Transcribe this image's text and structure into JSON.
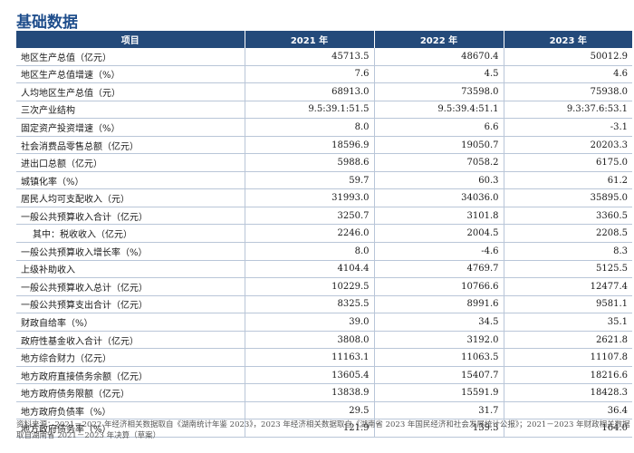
{
  "title": "基础数据",
  "table": {
    "headers": [
      "项目",
      "2021 年",
      "2022 年",
      "2023 年"
    ],
    "rows": [
      {
        "label": "地区生产总值（亿元）",
        "v2021": "45713.5",
        "v2022": "48670.4",
        "v2023": "50012.9"
      },
      {
        "label": "地区生产总值增速（%）",
        "v2021": "7.6",
        "v2022": "4.5",
        "v2023": "4.6"
      },
      {
        "label": "人均地区生产总值（元）",
        "v2021": "68913.0",
        "v2022": "73598.0",
        "v2023": "75938.0"
      },
      {
        "label": "三次产业结构",
        "v2021": "9.5:39.1:51.5",
        "v2022": "9.5:39.4:51.1",
        "v2023": "9.3:37.6:53.1"
      },
      {
        "label": "固定资产投资增速（%）",
        "v2021": "8.0",
        "v2022": "6.6",
        "v2023": "-3.1"
      },
      {
        "label": "社会消费品零售总额（亿元）",
        "v2021": "18596.9",
        "v2022": "19050.7",
        "v2023": "20203.3"
      },
      {
        "label": "进出口总额（亿元）",
        "v2021": "5988.6",
        "v2022": "7058.2",
        "v2023": "6175.0"
      },
      {
        "label": "城镇化率（%）",
        "v2021": "59.7",
        "v2022": "60.3",
        "v2023": "61.2"
      },
      {
        "label": "居民人均可支配收入（元）",
        "v2021": "31993.0",
        "v2022": "34036.0",
        "v2023": "35895.0"
      },
      {
        "label": "一般公共预算收入合计（亿元）",
        "v2021": "3250.7",
        "v2022": "3101.8",
        "v2023": "3360.5"
      },
      {
        "label": "其中：税收收入（亿元）",
        "v2021": "2246.0",
        "v2022": "2004.5",
        "v2023": "2208.5",
        "indent": true
      },
      {
        "label": "一般公共预算收入增长率（%）",
        "v2021": "8.0",
        "v2022": "-4.6",
        "v2023": "8.3"
      },
      {
        "label": "上级补助收入",
        "v2021": "4104.4",
        "v2022": "4769.7",
        "v2023": "5125.5"
      },
      {
        "label": "一般公共预算收入总计（亿元）",
        "v2021": "10229.5",
        "v2022": "10766.6",
        "v2023": "12477.4"
      },
      {
        "label": "一般公共预算支出合计（亿元）",
        "v2021": "8325.5",
        "v2022": "8991.6",
        "v2023": "9581.1"
      },
      {
        "label": "财政自给率（%）",
        "v2021": "39.0",
        "v2022": "34.5",
        "v2023": "35.1"
      },
      {
        "label": "政府性基金收入合计（亿元）",
        "v2021": "3808.0",
        "v2022": "3192.0",
        "v2023": "2621.8"
      },
      {
        "label": "地方综合财力（亿元）",
        "v2021": "11163.1",
        "v2022": "11063.5",
        "v2023": "11107.8"
      },
      {
        "label": "地方政府直接债务余额（亿元）",
        "v2021": "13605.4",
        "v2022": "15407.7",
        "v2023": "18216.6"
      },
      {
        "label": "地方政府债务限额（亿元）",
        "v2021": "13838.9",
        "v2022": "15591.9",
        "v2023": "18428.3"
      },
      {
        "label": "地方政府负债率（%）",
        "v2021": "29.5",
        "v2022": "31.7",
        "v2023": "36.4"
      },
      {
        "label": "地方政府债务率（%）",
        "v2021": "121.9",
        "v2022": "139.3",
        "v2023": "164.0"
      }
    ]
  },
  "source_note": "资料来源：2021－2022 年经济相关数据取自《湖南统计年鉴 2023》，2023 年经济相关数据取自《湖南省 2023 年国民经济和社会发展统计公报》；2021－2023 年财政相关数据取自湖南省 2021－2023 年决算（草案）"
}
